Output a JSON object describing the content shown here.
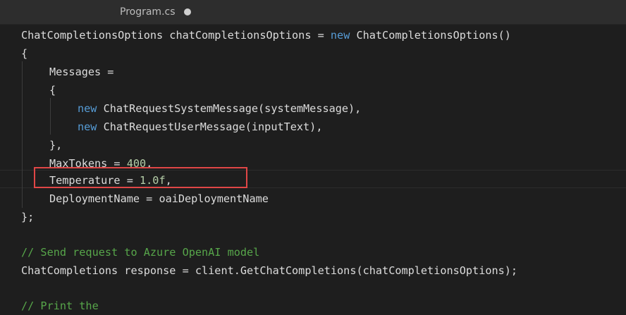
{
  "tab": {
    "filename": "Program.cs",
    "modified_indicator": "unsaved-dot-icon"
  },
  "code": {
    "l1": {
      "a": "ChatCompletionsOptions chatCompletionsOptions = ",
      "kw": "new",
      "b": " ChatCompletionsOptions()"
    },
    "l2": "{",
    "l3": "Messages =",
    "l4": "{",
    "l5": {
      "kw": "new",
      "b": " ChatRequestSystemMessage(systemMessage),"
    },
    "l6": {
      "kw": "new",
      "b": " ChatRequestUserMessage(inputText),"
    },
    "l7": "},",
    "l8": {
      "a": "MaxTokens = ",
      "num": "400",
      "b": ","
    },
    "l9": {
      "a": "Temperature = ",
      "num": "1.0f",
      "b": ","
    },
    "l10": "DeploymentName = oaiDeploymentName",
    "l11": "};",
    "l12": "// Send request to Azure OpenAI model",
    "l13": "ChatCompletions response = client.GetChatCompletions(chatCompletionsOptions);",
    "l14": "// Print the"
  },
  "colors": {
    "keyword": "#569cd6",
    "number": "#b5cea8",
    "comment": "#57a64a",
    "highlight_box": "#e04646"
  }
}
